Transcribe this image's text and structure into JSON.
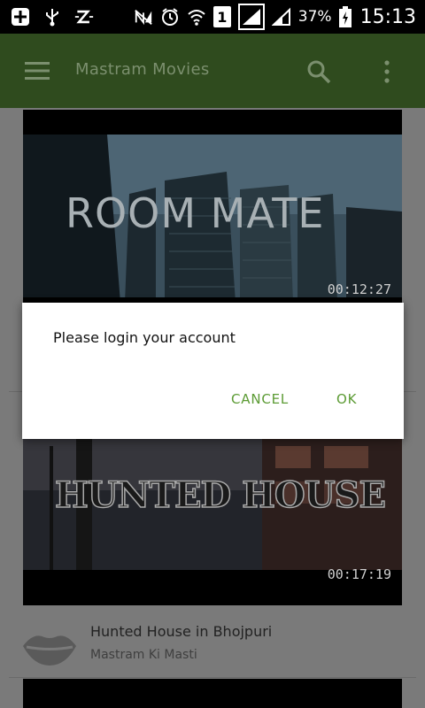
{
  "status_bar": {
    "icons": [
      "add-box-icon",
      "usb-icon",
      "z-app-icon",
      "no-signal-icon",
      "alarm-icon",
      "wifi-icon",
      "sim-slot-icon",
      "signal-icon",
      "signal-icon-2",
      "battery-charging-icon"
    ],
    "sim_number": "1",
    "battery_percent": "37%",
    "time": "15:13"
  },
  "toolbar": {
    "title": "Mastram Movies",
    "color": "#5c9b34"
  },
  "videos": [
    {
      "thumbnail_text": "ROOM MATE",
      "duration": "00:12:27"
    },
    {
      "thumbnail_text": "HUNTED HOUSE",
      "duration": "00:17:19",
      "title": "Hunted House in Bhojpuri",
      "channel": "Mastram Ki Masti"
    }
  ],
  "dialog": {
    "message": "Please login your account",
    "cancel_label": "CANCEL",
    "ok_label": "OK",
    "accent_color": "#5c9b34"
  }
}
